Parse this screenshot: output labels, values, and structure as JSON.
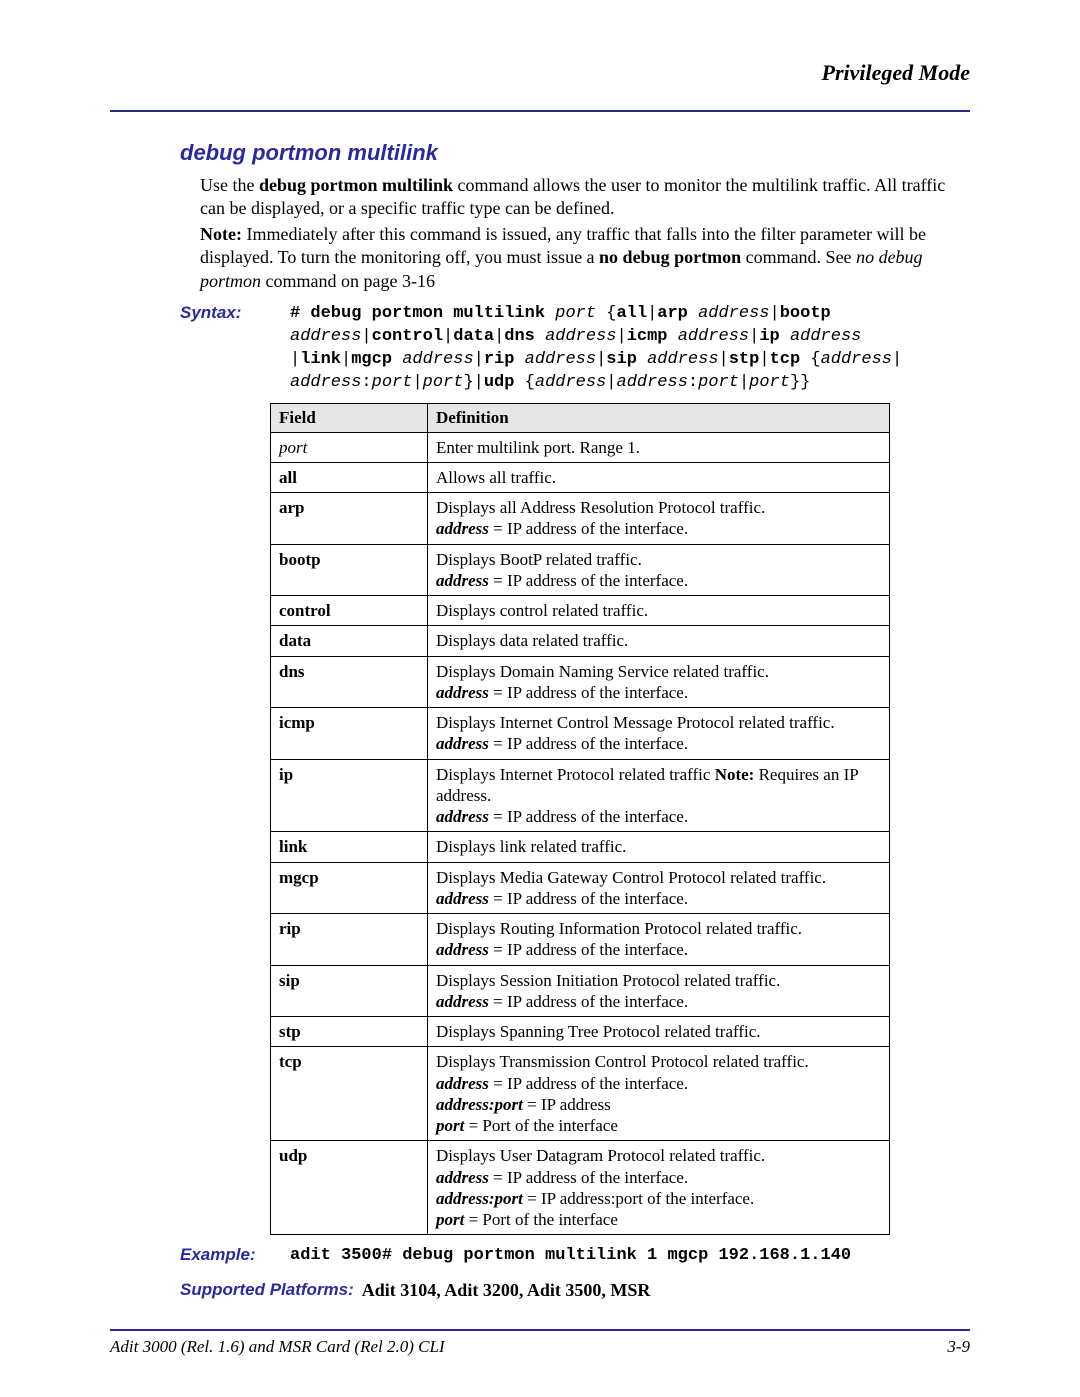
{
  "running_head": "Privileged Mode",
  "heading": "debug portmon multilink",
  "intro_html": "Use the <span class='tb'>debug portmon multilink</span> command allows the user to monitor the multilink traffic. All traffic can be displayed, or a specific traffic type can be defined.",
  "note_html": "<span class='tb'>Note:</span> Immediately after this command is issued, any traffic that falls into the filter parameter will be displayed. To turn the monitoring off, you must issue a <span class='tb'>no debug portmon</span> command. See <span class='ti'>no debug portmon</span> command on page 3-16",
  "syntax": {
    "label": "Syntax:",
    "mono_html": "<span class='kw'># debug portmon multilink</span> <span class='it'>port</span> {<span class='kw'>all</span>|<span class='kw'>arp</span> <span class='it'>address</span>|<span class='kw'>bootp</span> <span class='it'>address</span>|<span class='kw'>control</span>|<span class='kw'>data</span>|<span class='kw'>dns</span> <span class='it'>address</span>|<span class='kw'>icmp</span> <span class='it'>address</span>|<span class='kw'>ip</span> <span class='it'>address</span> |<span class='kw'>link</span>|<span class='kw'>mgcp</span> <span class='it'>address</span>|<span class='kw'>rip</span> <span class='it'>address</span>|<span class='kw'>sip</span> <span class='it'>address</span>|<span class='kw'>stp</span>|<span class='kw'>tcp</span> {<span class='it'>address</span>| <span class='it'>address</span>:<span class='it'>port</span>|<span class='it'>port</span>}|<span class='kw'>udp</span> {<span class='it'>address</span>|<span class='it'>address</span>:<span class='it'>port</span>|<span class='it'>port</span>}}"
  },
  "table": {
    "head_field": "Field",
    "head_def": "Definition",
    "rows": [
      {
        "field_html": "<span class='ti'>port</span>",
        "def_html": "Enter multilink port. Range 1."
      },
      {
        "field_html": "<span class='tb'>all</span>",
        "def_html": "Allows all traffic."
      },
      {
        "field_html": "<span class='tb'>arp</span>",
        "def_html": "Displays all Address Resolution Protocol traffic.<br><span class='tbi'>address</span> = IP address of the interface."
      },
      {
        "field_html": "<span class='tb'>bootp</span>",
        "def_html": "Displays BootP related traffic.<br><span class='tbi'>address</span> = IP address of the interface."
      },
      {
        "field_html": "<span class='tb'>control</span>",
        "def_html": "Displays control related traffic."
      },
      {
        "field_html": "<span class='tb'>data</span>",
        "def_html": "Displays data related traffic."
      },
      {
        "field_html": "<span class='tb'>dns</span>",
        "def_html": "Displays Domain Naming Service related traffic.<br><span class='tbi'>address</span> = IP address of the interface."
      },
      {
        "field_html": "<span class='tb'>icmp</span>",
        "def_html": "Displays Internet Control Message Protocol related traffic.<br><span class='tbi'>address</span> = IP address of the interface."
      },
      {
        "field_html": "<span class='tb'>ip</span>",
        "def_html": "Displays Internet Protocol related traffic <span class='tb'>Note:</span> Requires an IP address.<br><span class='tbi'>address</span> = IP address of the interface."
      },
      {
        "field_html": "<span class='tb'>link</span>",
        "def_html": "Displays link related traffic."
      },
      {
        "field_html": "<span class='tb'>mgcp</span>",
        "def_html": "Displays Media Gateway Control Protocol related traffic.<br><span class='tbi'>address</span> = IP address of the interface."
      },
      {
        "field_html": "<span class='tb'>rip</span>",
        "def_html": "Displays Routing Information Protocol related traffic.<br><span class='tbi'>address</span> = IP address of the interface."
      },
      {
        "field_html": "<span class='tb'>sip</span>",
        "def_html": "Displays Session Initiation Protocol related traffic.<br><span class='tbi'>address</span> = IP address of the interface."
      },
      {
        "field_html": "<span class='tb'>stp</span>",
        "def_html": "Displays Spanning Tree Protocol related traffic."
      },
      {
        "field_html": "<span class='tb'>tcp</span>",
        "def_html": "Displays Transmission Control Protocol related traffic.<br><span class='tbi'>address</span> = IP address of the interface.<br><span class='tbi'>address:port</span> = IP address<br><span class='tbi'>port</span> = Port of the interface"
      },
      {
        "field_html": "<span class='tb'>udp</span>",
        "def_html": "Displays User Datagram Protocol related traffic.<br><span class='tbi'>address</span> = IP address of the interface.<br><span class='tbi'>address:port</span> = IP address:port of the interface.<br><span class='tbi'>port</span> = Port of the interface"
      }
    ]
  },
  "example": {
    "label": "Example:",
    "mono_html": "<span class='kw'>adit 3500# debug portmon multilink 1 mgcp 192.168.1.140</span>"
  },
  "platforms": {
    "label": "Supported Platforms:",
    "value": "Adit 3104, Adit 3200, Adit 3500, MSR"
  },
  "footer": {
    "left": "Adit 3000 (Rel. 1.6) and MSR Card (Rel 2.0) CLI",
    "right": "3-9"
  }
}
